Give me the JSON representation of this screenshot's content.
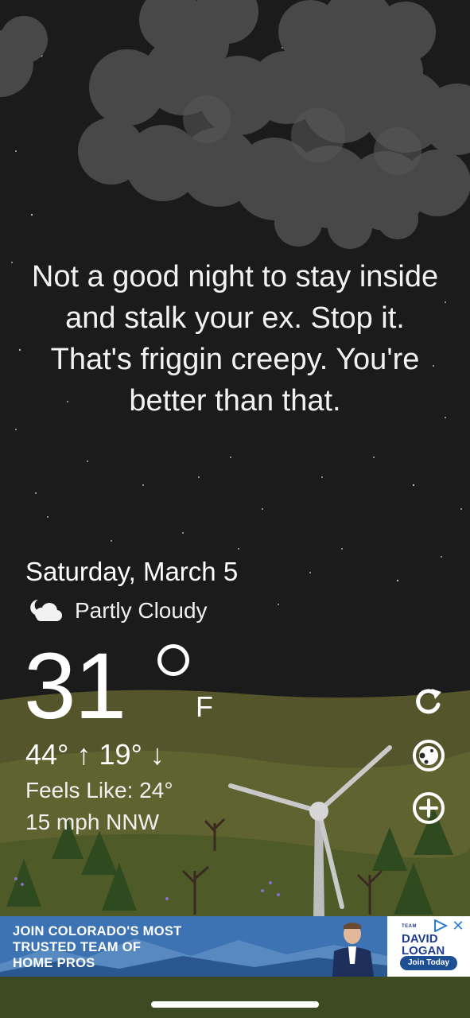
{
  "message": "Not a good night to stay inside and stalk your ex. Stop it. That's friggin creepy. You're better than that.",
  "date": "Saturday, March 5",
  "condition": {
    "text": "Partly Cloudy",
    "icon": "partly-cloudy-night-icon"
  },
  "temperature": {
    "value": "31",
    "unit": "F"
  },
  "hi_lo": "44° ↑ 19° ↓",
  "feels_like": "Feels Like: 24°",
  "wind": "15 mph NNW",
  "side_buttons": [
    {
      "name": "refresh-icon"
    },
    {
      "name": "theme-icon"
    },
    {
      "name": "add-location-icon"
    }
  ],
  "ad": {
    "headline_lines": [
      "JOIN COLORADO'S MOST",
      "TRUSTED TEAM OF",
      "HOME PROS"
    ],
    "brand": "DAVID LOGAN",
    "brand_small": "TEAM",
    "cta": "Join Today",
    "close_icon": "close-icon",
    "info_icon": "adchoices-icon"
  },
  "colors": {
    "sky": "#1b1b1b",
    "cloud": "#4a4a4a",
    "hill": "#5a5b2e",
    "ad_blue": "#2f66a8",
    "brand_blue": "#1f3e8a"
  }
}
